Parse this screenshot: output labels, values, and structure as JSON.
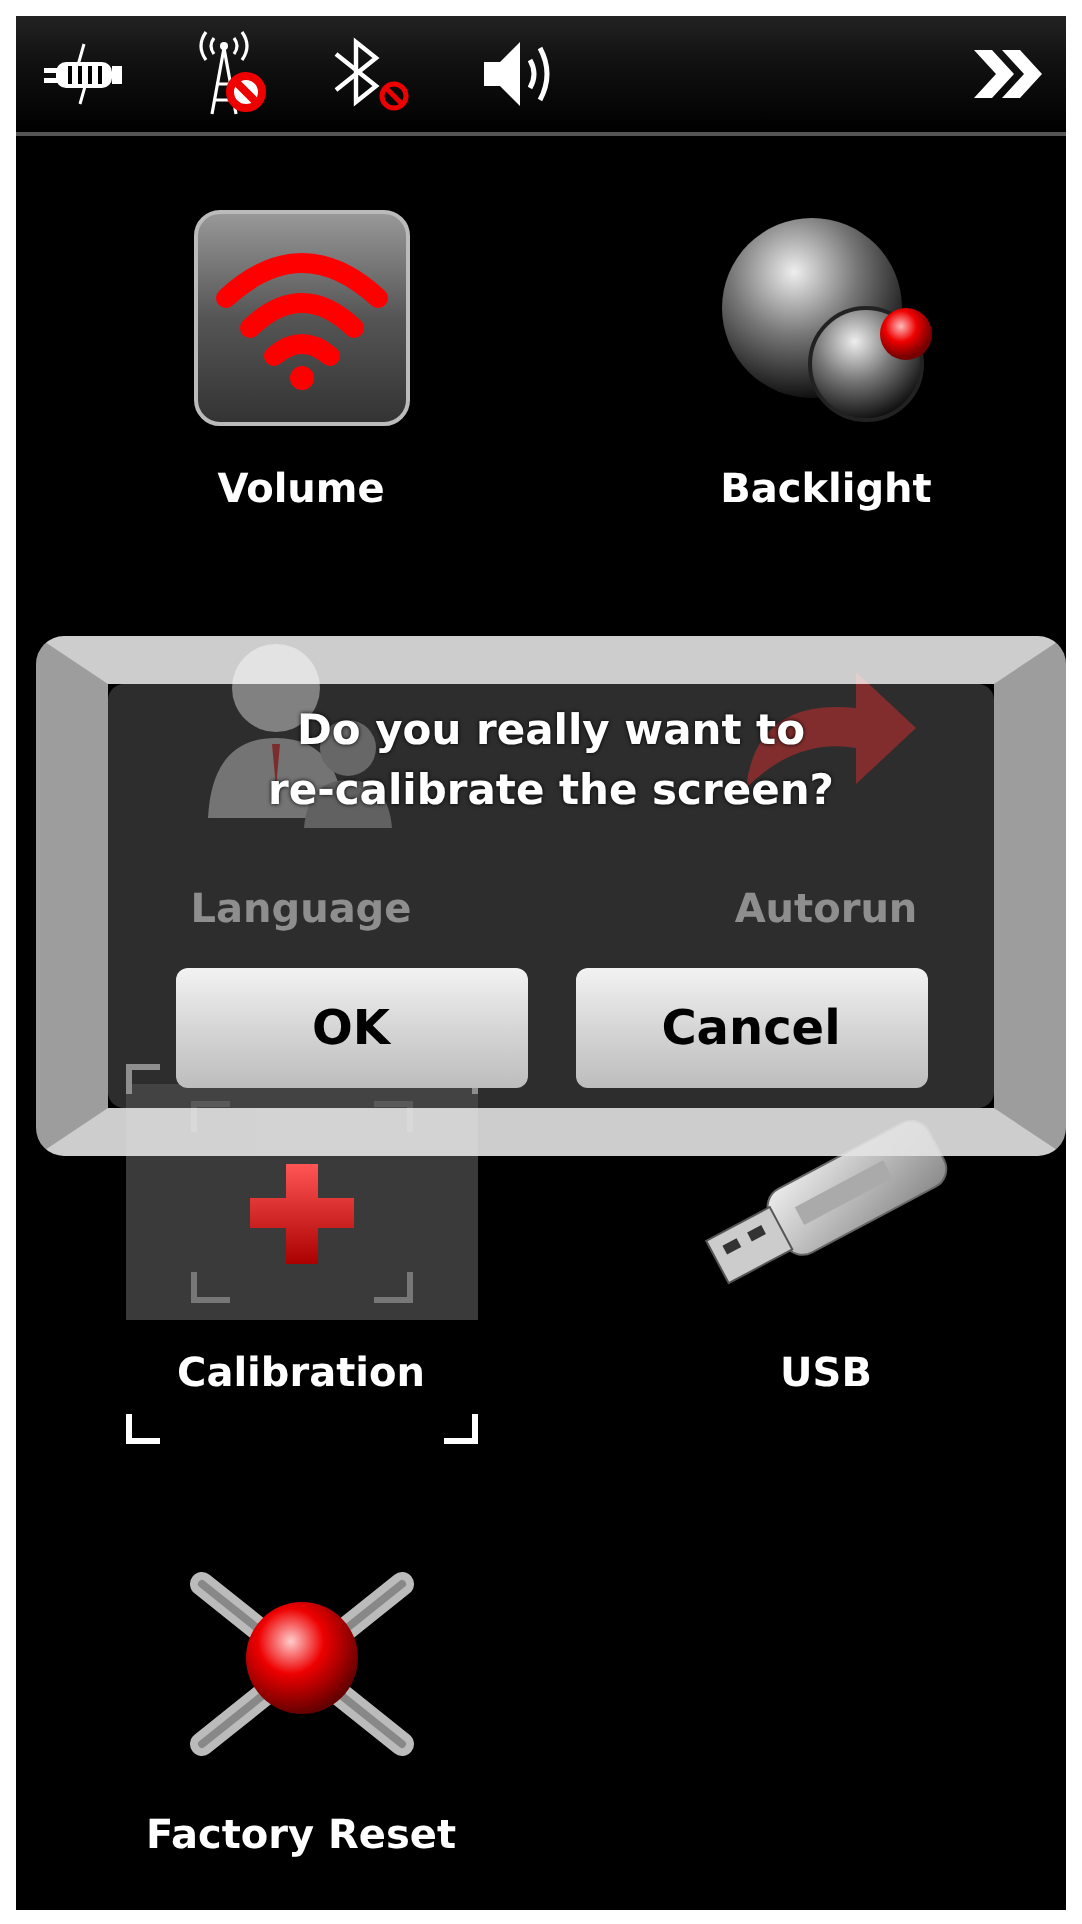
{
  "status_bar": {
    "icons": [
      {
        "kind": "plug"
      },
      {
        "kind": "antenna-off"
      },
      {
        "kind": "bluetooth-off"
      },
      {
        "kind": "speaker"
      }
    ]
  },
  "items": [
    {
      "kind": "volume",
      "label": "Volume",
      "selected": false
    },
    {
      "kind": "backlight",
      "label": "Backlight",
      "selected": false
    },
    {
      "kind": "language",
      "label": "Language",
      "selected": false
    },
    {
      "kind": "autorun",
      "label": "Autorun",
      "selected": false
    },
    {
      "kind": "calibration",
      "label": "Calibration",
      "selected": true
    },
    {
      "kind": "usb",
      "label": "USB",
      "selected": false
    },
    {
      "kind": "reset",
      "label": "Factory Reset",
      "selected": false
    }
  ],
  "dialog": {
    "message_lines": [
      "Do you really want to",
      "re-calibrate the screen?"
    ],
    "buttons": [
      "OK",
      "Cancel"
    ]
  }
}
